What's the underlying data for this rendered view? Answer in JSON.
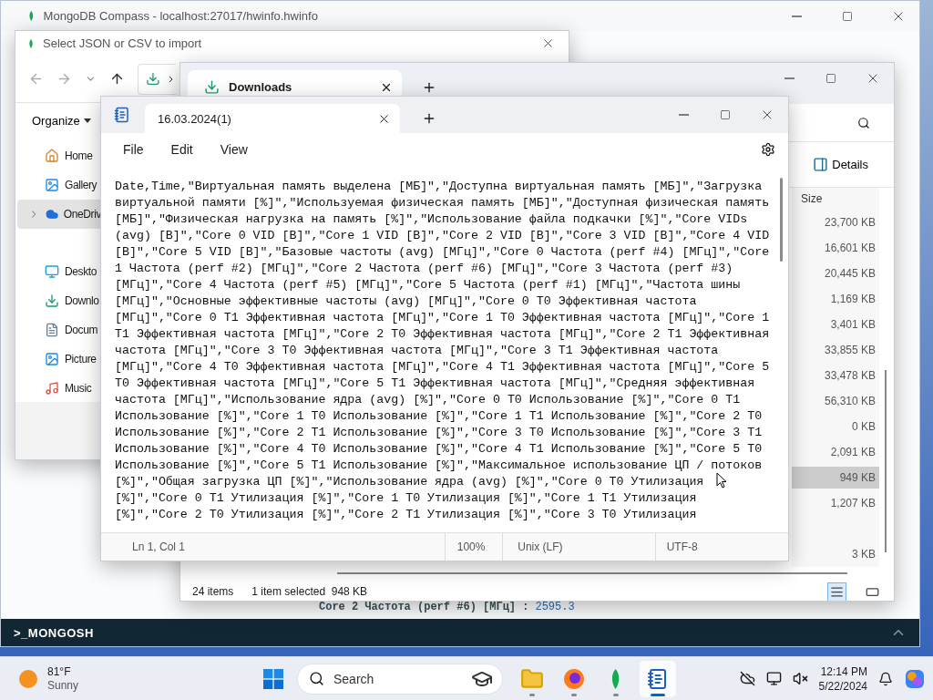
{
  "compass": {
    "title": "MongoDB Compass - localhost:27017/hwinfo.hwinfo",
    "shell_lines": [
      {
        "key": "Core 2 Частота (perf #6) [МГц] :",
        "value": "2595.3"
      }
    ],
    "shell_bar": {
      "label": ">_MONGOSH"
    }
  },
  "import_dialog": {
    "title": "Select JSON or CSV to import",
    "organize": "Organize",
    "sidebar": {
      "groups": [
        {
          "items": [
            {
              "kind": "home",
              "label": "Home",
              "selected": false,
              "expandable": false
            },
            {
              "kind": "gallery",
              "label": "Gallery",
              "selected": false,
              "expandable": false
            },
            {
              "kind": "cloud",
              "label": "OneDriv",
              "selected": true,
              "expandable": true
            }
          ]
        },
        {
          "items": [
            {
              "kind": "desktop",
              "label": "Deskto",
              "selected": false,
              "expandable": false
            },
            {
              "kind": "downloads",
              "label": "Downlo",
              "selected": false,
              "expandable": false
            },
            {
              "kind": "documents",
              "label": "Docum",
              "selected": false,
              "expandable": false
            },
            {
              "kind": "pictures",
              "label": "Picture",
              "selected": false,
              "expandable": false
            },
            {
              "kind": "music",
              "label": "Music",
              "selected": false,
              "expandable": false
            }
          ]
        }
      ]
    }
  },
  "explorer": {
    "tab": "Downloads",
    "details": "Details",
    "size_header": "Size",
    "rows": [
      {
        "size": "23,700 KB",
        "selected": false
      },
      {
        "size": "16,601 KB",
        "selected": false
      },
      {
        "size": "20,445 KB",
        "selected": false
      },
      {
        "size": "1,169 KB",
        "selected": false
      },
      {
        "size": "3,401 KB",
        "selected": false
      },
      {
        "size": "33,855 KB",
        "selected": false
      },
      {
        "size": "33,478 KB",
        "selected": false
      },
      {
        "size": "56,310 KB",
        "selected": false
      },
      {
        "size": "0 KB",
        "selected": false
      },
      {
        "size": "2,091 KB",
        "selected": false
      },
      {
        "size": "949 KB",
        "selected": true
      },
      {
        "size": "1,207 KB",
        "selected": false
      }
    ],
    "last_row": {
      "size": "3 KB"
    },
    "status": {
      "items": "24 items",
      "selection": "1 item selected",
      "selection_size": "948 KB"
    }
  },
  "notepad": {
    "tab": "16.03.2024(1)",
    "menu": [
      "File",
      "Edit",
      "View"
    ],
    "lines": [
      "Date,Time,\"Виртуальная память выделена [МБ]\",\"Доступна виртуальная память [МБ]\",\"Загрузка",
      "виртуальной памяти [%]\",\"Используемая физическая память [МБ]\",\"Доступная физическая память",
      "[МБ]\",\"Физическая нагрузка на память [%]\",\"Использование файла подкачки [%]\",\"Core VIDs",
      "(avg) [В]\",\"Core 0 VID [В]\",\"Core 1 VID [В]\",\"Core 2 VID [В]\",\"Core 3 VID [В]\",\"Core 4 VID",
      "[В]\",\"Core 5 VID [В]\",\"Базовые частоты (avg) [МГц]\",\"Core 0 Частота (perf #4) [МГц]\",\"Core",
      "1 Частота (perf #2) [МГц]\",\"Core 2 Частота (perf #6) [МГц]\",\"Core 3 Частота (perf #3)",
      "[МГц]\",\"Core 4 Частота (perf #5) [МГц]\",\"Core 5 Частота (perf #1) [МГц]\",\"Частота шины",
      "[МГц]\",\"Основные эффективные частоты (avg) [МГц]\",\"Core 0 T0 Эффективная частота",
      "[МГц]\",\"Core 0 T1 Эффективная частота [МГц]\",\"Core 1 T0 Эффективная частота [МГц]\",\"Core 1",
      "T1 Эффективная частота [МГц]\",\"Core 2 T0 Эффективная частота [МГц]\",\"Core 2 T1 Эффективная",
      "частота [МГц]\",\"Core 3 T0 Эффективная частота [МГц]\",\"Core 3 T1 Эффективная частота",
      "[МГц]\",\"Core 4 T0 Эффективная частота [МГц]\",\"Core 4 T1 Эффективная частота [МГц]\",\"Core 5",
      "T0 Эффективная частота [МГц]\",\"Core 5 T1 Эффективная частота [МГц]\",\"Средняя эффективная",
      "частота [МГц]\",\"Использование ядра (avg) [%]\",\"Core 0 T0 Использование [%]\",\"Core 0 T1",
      "Использование [%]\",\"Core 1 T0 Использование [%]\",\"Core 1 T1 Использование [%]\",\"Core 2 T0",
      "Использование [%]\",\"Core 2 T1 Использование [%]\",\"Core 3 T0 Использование [%]\",\"Core 3 T1",
      "Использование [%]\",\"Core 4 T0 Использование [%]\",\"Core 4 T1 Использование [%]\",\"Core 5 T0",
      "Использование [%]\",\"Core 5 T1 Использование [%]\",\"Максимальное использование ЦП / потоков",
      "[%]\",\"Общая загрузка ЦП [%]\",\"Использование ядра (avg) [%]\",\"Core 0 T0 Утилизация",
      "[%]\",\"Core 0 T1 Утилизация [%]\",\"Core 1 T0 Утилизация [%]\",\"Core 1 T1 Утилизация",
      "[%]\",\"Core 2 T0 Утилизация [%]\",\"Core 2 T1 Утилизация [%]\",\"Core 3 T0 Утилизация"
    ],
    "status": {
      "position": "Ln 1, Col 1",
      "zoom": "100%",
      "line_ending": "Unix (LF)",
      "encoding": "UTF-8"
    }
  },
  "taskbar": {
    "weather": {
      "temp": "81°F",
      "condition": "Sunny"
    },
    "search": {
      "placeholder": "Search"
    },
    "apps": [
      {
        "kind": "folder",
        "active": false
      },
      {
        "kind": "browser",
        "active": false
      },
      {
        "kind": "leaf",
        "active": false
      },
      {
        "kind": "notepad",
        "active": true
      }
    ],
    "clock": {
      "time": "12:14 PM",
      "date": "5/22/2024"
    }
  }
}
